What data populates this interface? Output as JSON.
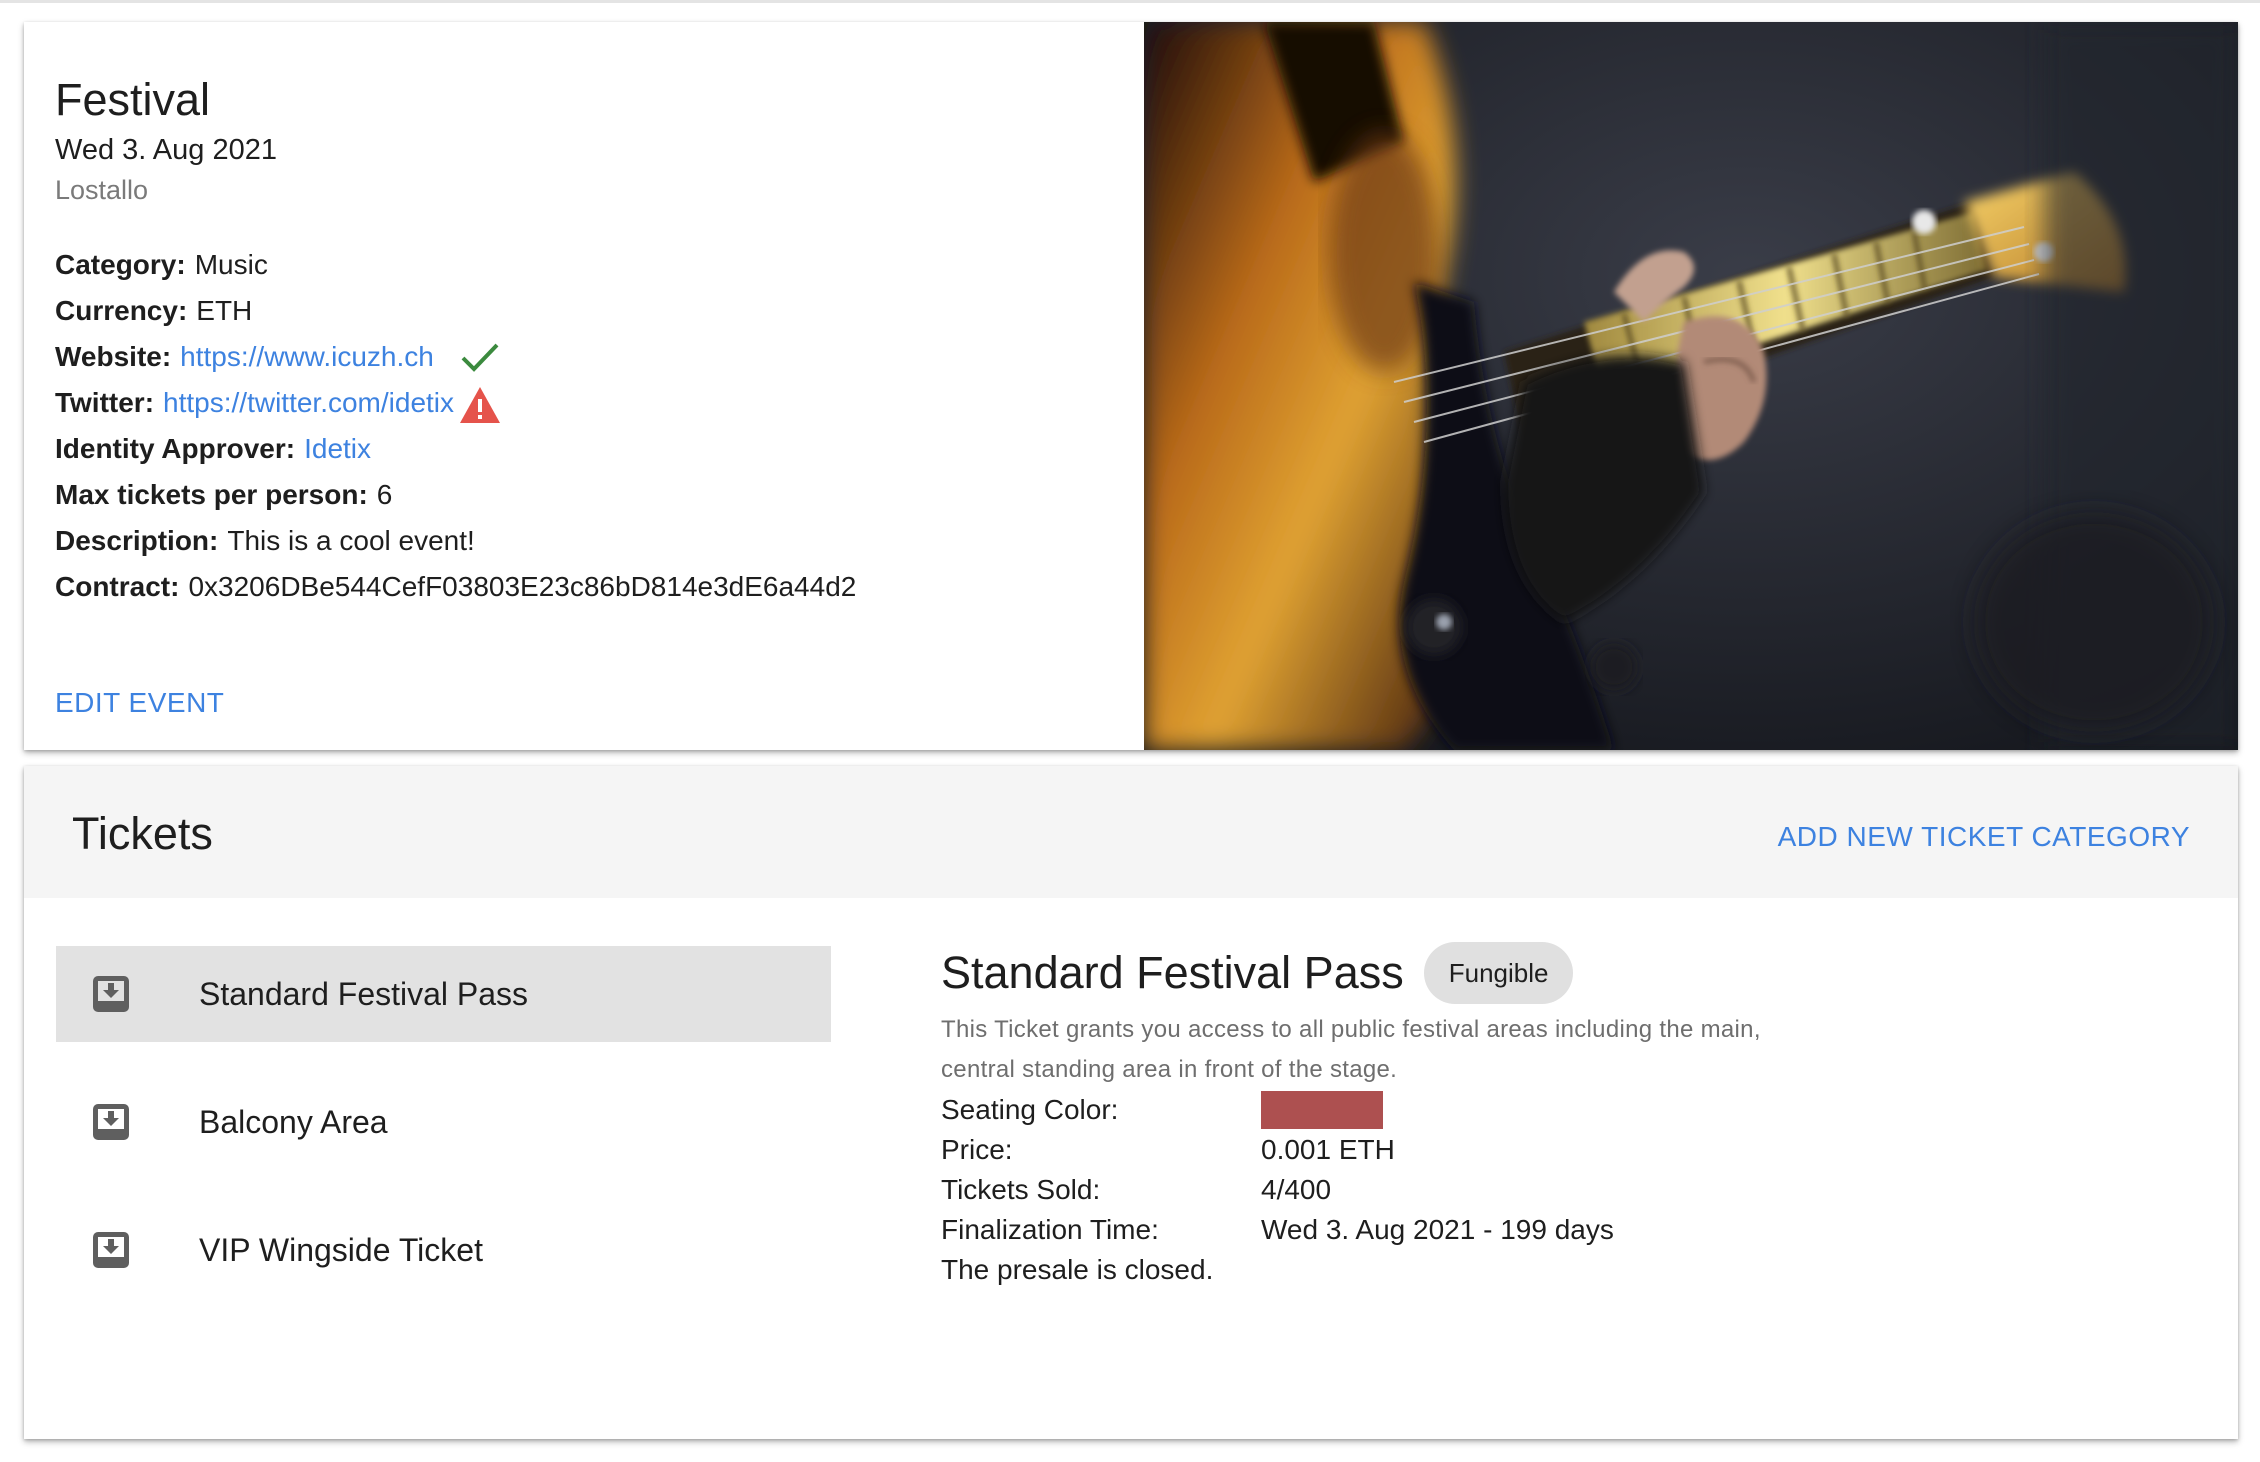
{
  "event": {
    "title": "Festival",
    "date": "Wed 3. Aug 2021",
    "location": "Lostallo",
    "details": {
      "category_label": "Category:",
      "category_value": "Music",
      "currency_label": "Currency:",
      "currency_value": "ETH",
      "website_label": "Website:",
      "website_value": "https://www.icuzh.ch",
      "website_status": "verified",
      "twitter_label": "Twitter:",
      "twitter_value": "https://twitter.com/idetix",
      "twitter_status": "warning",
      "approver_label": "Identity Approver:",
      "approver_value": "Idetix",
      "max_tickets_label": "Max tickets per person:",
      "max_tickets_value": "6",
      "description_label": "Description:",
      "description_value": "This is a cool event!",
      "contract_label": "Contract:",
      "contract_value": "0x3206DBe544CefF03803E23c86bD814e3dE6a44d2"
    },
    "edit_label": "EDIT EVENT"
  },
  "tickets": {
    "title": "Tickets",
    "add_label": "ADD NEW TICKET CATEGORY",
    "items": [
      {
        "label": "Standard Festival Pass",
        "icon": "inbox-download-icon",
        "selected": true
      },
      {
        "label": "Balcony Area",
        "icon": "inbox-download-icon",
        "selected": false
      },
      {
        "label": "VIP Wingside Ticket",
        "icon": "inbox-download-icon",
        "selected": false
      }
    ],
    "selected": {
      "title": "Standard Festival Pass",
      "badge": "Fungible",
      "description": "This Ticket grants you access to all public festival areas including the main, central standing area in front of the stage.",
      "seating_color_label": "Seating Color:",
      "seating_color": "#ad5050",
      "price_label": "Price:",
      "price_value": "0.001 ETH",
      "sold_label": "Tickets Sold:",
      "sold_value": "4/400",
      "finalization_label": "Finalization Time:",
      "finalization_value": "Wed 3. Aug 2021 - 199 days",
      "presale_status": "The presale is closed."
    }
  },
  "colors": {
    "accent": "#3d82e0",
    "check": "#3b8a3e",
    "warning": "#e5534b",
    "header_bg": "#f5f5f5",
    "selected_bg": "#e2e2e2"
  }
}
